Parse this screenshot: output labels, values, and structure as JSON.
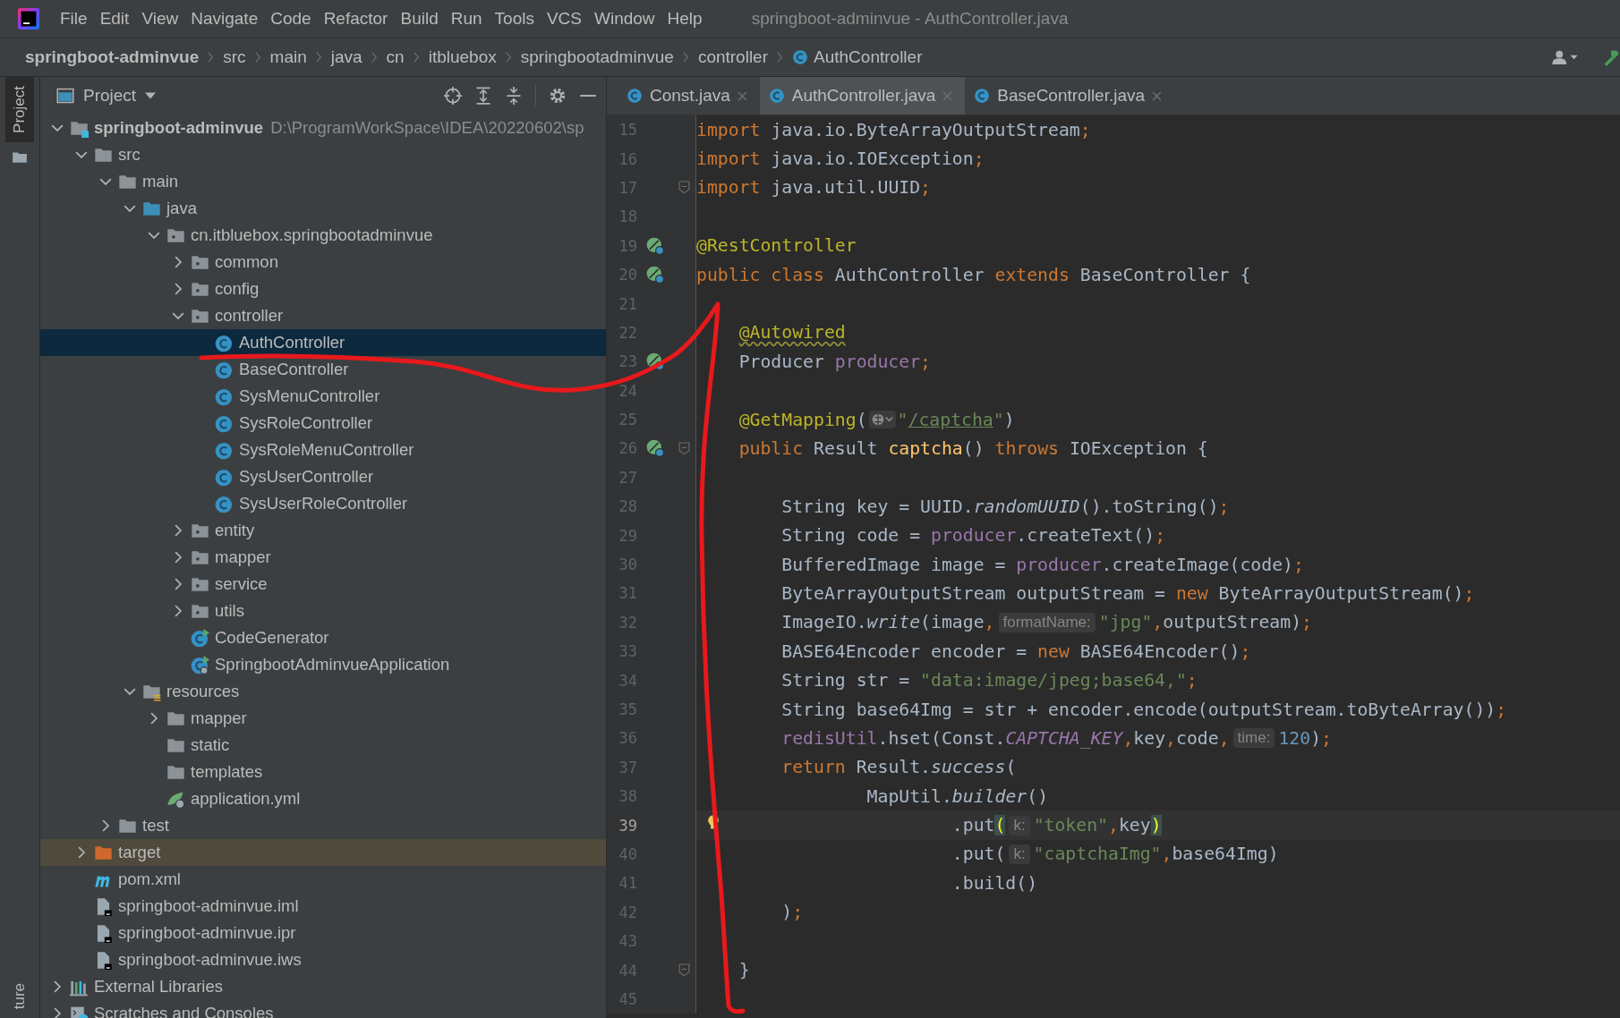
{
  "menu_bar": {
    "items": [
      "File",
      "Edit",
      "View",
      "Navigate",
      "Code",
      "Refactor",
      "Build",
      "Run",
      "Tools",
      "VCS",
      "Window",
      "Help"
    ],
    "title": "springboot-adminvue - AuthController.java"
  },
  "breadcrumbs": [
    {
      "label": "springboot-adminvue",
      "kind": "project"
    },
    {
      "label": "src",
      "kind": "plain"
    },
    {
      "label": "main",
      "kind": "plain"
    },
    {
      "label": "java",
      "kind": "plain"
    },
    {
      "label": "cn",
      "kind": "plain"
    },
    {
      "label": "itbluebox",
      "kind": "plain"
    },
    {
      "label": "springbootadminvue",
      "kind": "plain"
    },
    {
      "label": "controller",
      "kind": "plain"
    },
    {
      "label": "AuthController",
      "kind": "class"
    }
  ],
  "side_stripe": {
    "top": [
      {
        "label": "Project",
        "selected": true
      }
    ],
    "bottom": [
      {
        "label": "ture",
        "selected": false
      }
    ]
  },
  "project_panel": {
    "title": "Project",
    "tree": [
      {
        "label": "springboot-adminvue",
        "path": "D:\\ProgramWorkSpace\\IDEA\\20220602\\sp",
        "kind": "module",
        "expanded": true,
        "selected": false,
        "highlighted": false,
        "children": [
          {
            "label": "src",
            "kind": "folder",
            "expanded": true,
            "selected": false,
            "highlighted": false,
            "children": [
              {
                "label": "main",
                "kind": "folder",
                "expanded": true,
                "selected": false,
                "highlighted": false,
                "children": [
                  {
                    "label": "java",
                    "kind": "source-folder",
                    "expanded": true,
                    "selected": false,
                    "highlighted": false,
                    "children": [
                      {
                        "label": "cn.itbluebox.springbootadminvue",
                        "kind": "package",
                        "expanded": true,
                        "selected": false,
                        "highlighted": false,
                        "children": [
                          {
                            "label": "common",
                            "kind": "package",
                            "expanded": false,
                            "selected": false,
                            "highlighted": false
                          },
                          {
                            "label": "config",
                            "kind": "package",
                            "expanded": false,
                            "selected": false,
                            "highlighted": false
                          },
                          {
                            "label": "controller",
                            "kind": "package",
                            "expanded": true,
                            "selected": false,
                            "highlighted": false,
                            "children": [
                              {
                                "label": "AuthController",
                                "kind": "class",
                                "selected": true,
                                "highlighted": false
                              },
                              {
                                "label": "BaseController",
                                "kind": "class",
                                "selected": false,
                                "highlighted": false
                              },
                              {
                                "label": "SysMenuController",
                                "kind": "class",
                                "selected": false,
                                "highlighted": false
                              },
                              {
                                "label": "SysRoleController",
                                "kind": "class",
                                "selected": false,
                                "highlighted": false
                              },
                              {
                                "label": "SysRoleMenuController",
                                "kind": "class",
                                "selected": false,
                                "highlighted": false
                              },
                              {
                                "label": "SysUserController",
                                "kind": "class",
                                "selected": false,
                                "highlighted": false
                              },
                              {
                                "label": "SysUserRoleController",
                                "kind": "class",
                                "selected": false,
                                "highlighted": false
                              }
                            ]
                          },
                          {
                            "label": "entity",
                            "kind": "package",
                            "expanded": false,
                            "selected": false,
                            "highlighted": false
                          },
                          {
                            "label": "mapper",
                            "kind": "package",
                            "expanded": false,
                            "selected": false,
                            "highlighted": false
                          },
                          {
                            "label": "service",
                            "kind": "package",
                            "expanded": false,
                            "selected": false,
                            "highlighted": false
                          },
                          {
                            "label": "utils",
                            "kind": "package",
                            "expanded": false,
                            "selected": false,
                            "highlighted": false
                          },
                          {
                            "label": "CodeGenerator",
                            "kind": "runnable-class",
                            "selected": false,
                            "highlighted": false
                          },
                          {
                            "label": "SpringbootAdminvueApplication",
                            "kind": "spring-app",
                            "selected": false,
                            "highlighted": false
                          }
                        ]
                      }
                    ]
                  },
                  {
                    "label": "resources",
                    "kind": "resources-folder",
                    "expanded": true,
                    "selected": false,
                    "highlighted": false,
                    "children": [
                      {
                        "label": "mapper",
                        "kind": "folder",
                        "expanded": false,
                        "selected": false,
                        "highlighted": false
                      },
                      {
                        "label": "static",
                        "kind": "folder",
                        "selected": false,
                        "highlighted": false
                      },
                      {
                        "label": "templates",
                        "kind": "folder",
                        "selected": false,
                        "highlighted": false
                      },
                      {
                        "label": "application.yml",
                        "kind": "yml",
                        "selected": false,
                        "highlighted": false
                      }
                    ]
                  }
                ]
              },
              {
                "label": "test",
                "kind": "folder",
                "expanded": false,
                "selected": false,
                "highlighted": false
              }
            ]
          },
          {
            "label": "target",
            "kind": "excluded-folder",
            "expanded": false,
            "selected": false,
            "highlighted": true
          },
          {
            "label": "pom.xml",
            "kind": "maven",
            "selected": false,
            "highlighted": false
          },
          {
            "label": "springboot-adminvue.iml",
            "kind": "file",
            "selected": false,
            "highlighted": false
          },
          {
            "label": "springboot-adminvue.ipr",
            "kind": "file",
            "selected": false,
            "highlighted": false
          },
          {
            "label": "springboot-adminvue.iws",
            "kind": "file",
            "selected": false,
            "highlighted": false
          }
        ]
      },
      {
        "label": "External Libraries",
        "kind": "library",
        "expanded": false,
        "selected": false,
        "highlighted": false
      },
      {
        "label": "Scratches and Consoles",
        "kind": "scratch",
        "expanded": false,
        "selected": false,
        "highlighted": false
      }
    ]
  },
  "editor": {
    "tabs": [
      {
        "label": "Const.java",
        "selected": false
      },
      {
        "label": "AuthController.java",
        "selected": true
      },
      {
        "label": "BaseController.java",
        "selected": false
      }
    ],
    "lines": [
      {
        "number": "15",
        "current": false,
        "segments": [
          {
            "kind": "keyword",
            "text": "import"
          },
          {
            "kind": "plain",
            "text": " java.io.ByteArrayOutputStream"
          },
          {
            "kind": "keyword",
            "text": ";"
          }
        ]
      },
      {
        "number": "16",
        "current": false,
        "segments": [
          {
            "kind": "keyword",
            "text": "import"
          },
          {
            "kind": "plain",
            "text": " java.io.IOException"
          },
          {
            "kind": "keyword",
            "text": ";"
          }
        ]
      },
      {
        "number": "17",
        "current": false,
        "gutter": [
          {
            "kind": "fold"
          }
        ],
        "segments": [
          {
            "kind": "keyword",
            "text": "import"
          },
          {
            "kind": "plain",
            "text": " java.util.UUID"
          },
          {
            "kind": "keyword",
            "text": ";"
          }
        ]
      },
      {
        "number": "18",
        "current": false
      },
      {
        "number": "19",
        "current": false,
        "gutter": [
          {
            "kind": "bean"
          }
        ],
        "segments": [
          {
            "kind": "annotation",
            "text": "@RestController"
          }
        ]
      },
      {
        "number": "20",
        "current": false,
        "gutter": [
          {
            "kind": "bean"
          }
        ],
        "segments": [
          {
            "kind": "keyword",
            "text": "public class"
          },
          {
            "kind": "plain",
            "text": " AuthController "
          },
          {
            "kind": "keyword",
            "text": "extends"
          },
          {
            "kind": "plain",
            "text": " BaseController {"
          }
        ]
      },
      {
        "number": "21",
        "current": false
      },
      {
        "number": "22",
        "current": false,
        "segments": [
          {
            "kind": "annotation-warning",
            "text": "    @Autowired"
          }
        ]
      },
      {
        "number": "23",
        "current": false,
        "gutter": [
          {
            "kind": "bean"
          }
        ],
        "segments": [
          {
            "kind": "plain",
            "text": "    Producer "
          },
          {
            "kind": "field",
            "text": "producer"
          },
          {
            "kind": "keyword",
            "text": ";"
          }
        ]
      },
      {
        "number": "24",
        "current": false
      },
      {
        "number": "25",
        "current": false,
        "segments": [
          {
            "kind": "annotation",
            "text": "    @GetMapping"
          },
          {
            "kind": "plain",
            "text": "("
          },
          {
            "kind": "web-icon"
          },
          {
            "kind": "string",
            "text": "\""
          },
          {
            "kind": "url",
            "text": "/captcha"
          },
          {
            "kind": "string",
            "text": "\""
          },
          {
            "kind": "plain",
            "text": ")"
          }
        ]
      },
      {
        "number": "26",
        "current": false,
        "gutter": [
          {
            "kind": "bean"
          },
          {
            "kind": "fold"
          }
        ],
        "segments": [
          {
            "kind": "keyword",
            "text": "    public"
          },
          {
            "kind": "plain",
            "text": " Result "
          },
          {
            "kind": "method",
            "text": "captcha"
          },
          {
            "kind": "plain",
            "text": "() "
          },
          {
            "kind": "keyword",
            "text": "throws"
          },
          {
            "kind": "plain",
            "text": " IOException {"
          }
        ]
      },
      {
        "number": "27",
        "current": false
      },
      {
        "number": "28",
        "current": false,
        "segments": [
          {
            "kind": "plain",
            "text": "        String key = UUID."
          },
          {
            "kind": "static-call",
            "text": "randomUUID"
          },
          {
            "kind": "plain",
            "text": "().toString()"
          },
          {
            "kind": "keyword",
            "text": ";"
          }
        ]
      },
      {
        "number": "29",
        "current": false,
        "segments": [
          {
            "kind": "plain",
            "text": "        String code = "
          },
          {
            "kind": "field",
            "text": "producer"
          },
          {
            "kind": "plain",
            "text": ".createText()"
          },
          {
            "kind": "keyword",
            "text": ";"
          }
        ]
      },
      {
        "number": "30",
        "current": false,
        "segments": [
          {
            "kind": "plain",
            "text": "        BufferedImage image = "
          },
          {
            "kind": "field",
            "text": "producer"
          },
          {
            "kind": "plain",
            "text": ".createImage(code)"
          },
          {
            "kind": "keyword",
            "text": ";"
          }
        ]
      },
      {
        "number": "31",
        "current": false,
        "segments": [
          {
            "kind": "plain",
            "text": "        ByteArrayOutputStream outputStream = "
          },
          {
            "kind": "keyword",
            "text": "new"
          },
          {
            "kind": "plain",
            "text": " ByteArrayOutputStream()"
          },
          {
            "kind": "keyword",
            "text": ";"
          }
        ]
      },
      {
        "number": "32",
        "current": false,
        "segments": [
          {
            "kind": "plain",
            "text": "        ImageIO."
          },
          {
            "kind": "static-call",
            "text": "write"
          },
          {
            "kind": "plain",
            "text": "(image"
          },
          {
            "kind": "keyword",
            "text": ","
          },
          {
            "kind": "hint",
            "text": "formatName:"
          },
          {
            "kind": "string",
            "text": "\"jpg\""
          },
          {
            "kind": "keyword",
            "text": ","
          },
          {
            "kind": "plain",
            "text": "outputStream)"
          },
          {
            "kind": "keyword",
            "text": ";"
          }
        ]
      },
      {
        "number": "33",
        "current": false,
        "segments": [
          {
            "kind": "plain",
            "text": "        BASE64Encoder encoder = "
          },
          {
            "kind": "keyword",
            "text": "new"
          },
          {
            "kind": "plain",
            "text": " BASE64Encoder()"
          },
          {
            "kind": "keyword",
            "text": ";"
          }
        ]
      },
      {
        "number": "34",
        "current": false,
        "segments": [
          {
            "kind": "plain",
            "text": "        String str = "
          },
          {
            "kind": "string",
            "text": "\"data:image/jpeg;base64,\""
          },
          {
            "kind": "keyword",
            "text": ";"
          }
        ]
      },
      {
        "number": "35",
        "current": false,
        "segments": [
          {
            "kind": "plain",
            "text": "        String base64Img = str + encoder.encode(outputStream.toByteArray())"
          },
          {
            "kind": "keyword",
            "text": ";"
          }
        ]
      },
      {
        "number": "36",
        "current": false,
        "segments": [
          {
            "kind": "field",
            "text": "        redisUtil"
          },
          {
            "kind": "plain",
            "text": ".hset(Const."
          },
          {
            "kind": "constant",
            "text": "CAPTCHA_KEY"
          },
          {
            "kind": "keyword",
            "text": ","
          },
          {
            "kind": "plain",
            "text": "key"
          },
          {
            "kind": "keyword",
            "text": ","
          },
          {
            "kind": "plain",
            "text": "code"
          },
          {
            "kind": "keyword",
            "text": ","
          },
          {
            "kind": "hint",
            "text": "time:"
          },
          {
            "kind": "number",
            "text": "120"
          },
          {
            "kind": "plain",
            "text": ")"
          },
          {
            "kind": "keyword",
            "text": ";"
          }
        ]
      },
      {
        "number": "37",
        "current": false,
        "segments": [
          {
            "kind": "keyword",
            "text": "        return"
          },
          {
            "kind": "plain",
            "text": " Result."
          },
          {
            "kind": "static-call",
            "text": "success"
          },
          {
            "kind": "plain",
            "text": "("
          }
        ]
      },
      {
        "number": "38",
        "current": false,
        "segments": [
          {
            "kind": "plain",
            "text": "                MapUtil."
          },
          {
            "kind": "static-call",
            "text": "builder"
          },
          {
            "kind": "plain",
            "text": "()"
          }
        ]
      },
      {
        "number": "39",
        "current": true,
        "gutter": [
          {
            "kind": "bulb"
          }
        ],
        "segments": [
          {
            "kind": "plain",
            "text": "                        .put"
          },
          {
            "kind": "brace-match",
            "text": "("
          },
          {
            "kind": "hint",
            "text": "k:"
          },
          {
            "kind": "string",
            "text": "\"token\""
          },
          {
            "kind": "keyword",
            "text": ","
          },
          {
            "kind": "plain",
            "text": "key"
          },
          {
            "kind": "brace-match",
            "text": ")"
          }
        ]
      },
      {
        "number": "40",
        "current": false,
        "segments": [
          {
            "kind": "plain",
            "text": "                        .put("
          },
          {
            "kind": "hint",
            "text": "k:"
          },
          {
            "kind": "string",
            "text": "\"captchaImg\""
          },
          {
            "kind": "keyword",
            "text": ","
          },
          {
            "kind": "plain",
            "text": "base64Img)"
          }
        ]
      },
      {
        "number": "41",
        "current": false,
        "segments": [
          {
            "kind": "plain",
            "text": "                        .build()"
          }
        ]
      },
      {
        "number": "42",
        "current": false,
        "segments": [
          {
            "kind": "plain",
            "text": "        )"
          },
          {
            "kind": "keyword",
            "text": ";"
          }
        ]
      },
      {
        "number": "43",
        "current": false
      },
      {
        "number": "44",
        "current": false,
        "gutter": [
          {
            "kind": "fold"
          }
        ],
        "segments": [
          {
            "kind": "plain",
            "text": "    }"
          }
        ]
      },
      {
        "number": "45",
        "current": false
      }
    ]
  }
}
